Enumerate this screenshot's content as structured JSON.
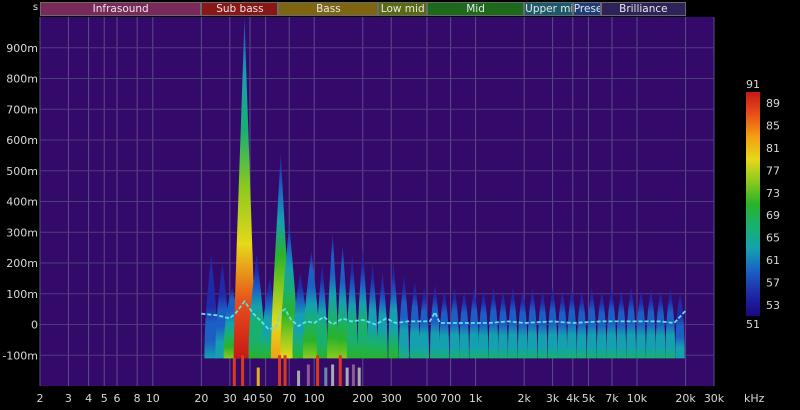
{
  "app": {
    "unit_label": "s"
  },
  "band_strip": [
    {
      "label": "Infrasound",
      "from": 2,
      "to": 20,
      "color": "#7a2a5a"
    },
    {
      "label": "Sub bass",
      "from": 20,
      "to": 60,
      "color": "#8a1616"
    },
    {
      "label": "Bass",
      "from": 60,
      "to": 250,
      "color": "#7d6512"
    },
    {
      "label": "Low mid",
      "from": 250,
      "to": 500,
      "color": "#5a6a12"
    },
    {
      "label": "Mid",
      "from": 500,
      "to": 2000,
      "color": "#1d6a1d"
    },
    {
      "label": "Upper mi",
      "from": 2000,
      "to": 4000,
      "color": "#1a5a6a"
    },
    {
      "label": "Prese",
      "from": 4000,
      "to": 6000,
      "color": "#1c3c7a"
    },
    {
      "label": "Brilliance",
      "from": 6000,
      "to": 20000,
      "color": "#2e2258"
    }
  ],
  "chart_data": {
    "type": "heatmap",
    "title": "",
    "xscale": "log",
    "xlim": [
      2,
      30000
    ],
    "ylim": [
      -200,
      1000
    ],
    "xlabel": "kHz",
    "x_ticks": [
      {
        "v": 2,
        "label": "2"
      },
      {
        "v": 3,
        "label": "3"
      },
      {
        "v": 4,
        "label": "4"
      },
      {
        "v": 5,
        "label": "5"
      },
      {
        "v": 6,
        "label": "6"
      },
      {
        "v": 8,
        "label": "8"
      },
      {
        "v": 10,
        "label": "10"
      },
      {
        "v": 20,
        "label": "20"
      },
      {
        "v": 30,
        "label": "30"
      },
      {
        "v": 40,
        "label": "40"
      },
      {
        "v": 50,
        "label": "50"
      },
      {
        "v": 70,
        "label": "70"
      },
      {
        "v": 100,
        "label": "100"
      },
      {
        "v": 200,
        "label": "200"
      },
      {
        "v": 300,
        "label": "300"
      },
      {
        "v": 500,
        "label": "500"
      },
      {
        "v": 700,
        "label": "700"
      },
      {
        "v": 1000,
        "label": "1k"
      },
      {
        "v": 2000,
        "label": "2k"
      },
      {
        "v": 3000,
        "label": "3k"
      },
      {
        "v": 4000,
        "label": "4k"
      },
      {
        "v": 5000,
        "label": "5k"
      },
      {
        "v": 7000,
        "label": "7k"
      },
      {
        "v": 10000,
        "label": "10k"
      },
      {
        "v": 20000,
        "label": "20k"
      },
      {
        "v": 30000,
        "label": "30k"
      }
    ],
    "y_ticks": [
      {
        "v": 900,
        "label": "900m"
      },
      {
        "v": 800,
        "label": "800m"
      },
      {
        "v": 700,
        "label": "700m"
      },
      {
        "v": 600,
        "label": "600m"
      },
      {
        "v": 500,
        "label": "500m"
      },
      {
        "v": 400,
        "label": "400m"
      },
      {
        "v": 300,
        "label": "300m"
      },
      {
        "v": 200,
        "label": "200m"
      },
      {
        "v": 100,
        "label": "100m"
      },
      {
        "v": 0,
        "label": "0"
      },
      {
        "v": -100,
        "label": "-100m"
      }
    ],
    "colorbar": {
      "max_label": "91",
      "min_label": "51",
      "ticks": [
        "89",
        "85",
        "81",
        "77",
        "73",
        "69",
        "65",
        "61",
        "57",
        "53"
      ],
      "range": [
        51,
        91
      ],
      "colors": [
        "#1a0880",
        "#1e2aa8",
        "#1c5fc4",
        "#15a0b0",
        "#18b070",
        "#29b329",
        "#8cc91e",
        "#e6d81a",
        "#f2a012",
        "#e8501a",
        "#c81818"
      ]
    },
    "background": "#33096a",
    "peaks": [
      {
        "f": 23,
        "top": 230,
        "level": 0.25
      },
      {
        "f": 27,
        "top": 200,
        "level": 0.3
      },
      {
        "f": 31,
        "top": 120,
        "level": 0.55
      },
      {
        "f": 37,
        "top": 1000,
        "level": 1.0
      },
      {
        "f": 44,
        "top": 230,
        "level": 0.5
      },
      {
        "f": 53,
        "top": 150,
        "level": 0.45
      },
      {
        "f": 62,
        "top": 560,
        "level": 0.8
      },
      {
        "f": 70,
        "top": 330,
        "level": 0.65
      },
      {
        "f": 82,
        "top": 170,
        "level": 0.45
      },
      {
        "f": 96,
        "top": 240,
        "level": 0.55
      },
      {
        "f": 112,
        "top": 200,
        "level": 0.5
      },
      {
        "f": 130,
        "top": 300,
        "level": 0.55
      },
      {
        "f": 150,
        "top": 260,
        "level": 0.55
      },
      {
        "f": 172,
        "top": 230,
        "level": 0.5
      },
      {
        "f": 200,
        "top": 250,
        "level": 0.5
      },
      {
        "f": 230,
        "top": 200,
        "level": 0.45
      },
      {
        "f": 265,
        "top": 170,
        "level": 0.45
      },
      {
        "f": 310,
        "top": 200,
        "level": 0.45
      },
      {
        "f": 360,
        "top": 160,
        "level": 0.4
      },
      {
        "f": 420,
        "top": 140,
        "level": 0.4
      },
      {
        "f": 480,
        "top": 120,
        "level": 0.35
      },
      {
        "f": 560,
        "top": 130,
        "level": 0.35
      },
      {
        "f": 640,
        "top": 110,
        "level": 0.35
      },
      {
        "f": 740,
        "top": 120,
        "level": 0.35
      },
      {
        "f": 850,
        "top": 110,
        "level": 0.35
      },
      {
        "f": 980,
        "top": 120,
        "level": 0.35
      },
      {
        "f": 1120,
        "top": 110,
        "level": 0.35
      },
      {
        "f": 1290,
        "top": 120,
        "level": 0.35
      },
      {
        "f": 1480,
        "top": 110,
        "level": 0.35
      },
      {
        "f": 1700,
        "top": 120,
        "level": 0.35
      },
      {
        "f": 1960,
        "top": 110,
        "level": 0.35
      },
      {
        "f": 2250,
        "top": 120,
        "level": 0.35
      },
      {
        "f": 2600,
        "top": 110,
        "level": 0.35
      },
      {
        "f": 3000,
        "top": 120,
        "level": 0.35
      },
      {
        "f": 3450,
        "top": 110,
        "level": 0.35
      },
      {
        "f": 3950,
        "top": 120,
        "level": 0.35
      },
      {
        "f": 4550,
        "top": 110,
        "level": 0.35
      },
      {
        "f": 5250,
        "top": 120,
        "level": 0.35
      },
      {
        "f": 6050,
        "top": 110,
        "level": 0.35
      },
      {
        "f": 6950,
        "top": 120,
        "level": 0.35
      },
      {
        "f": 8000,
        "top": 110,
        "level": 0.35
      },
      {
        "f": 9200,
        "top": 120,
        "level": 0.35
      },
      {
        "f": 10600,
        "top": 110,
        "level": 0.35
      },
      {
        "f": 12200,
        "top": 115,
        "level": 0.35
      },
      {
        "f": 14000,
        "top": 110,
        "level": 0.35
      },
      {
        "f": 16100,
        "top": 115,
        "level": 0.35
      },
      {
        "f": 18500,
        "top": 100,
        "level": 0.3
      }
    ],
    "centroid_line": {
      "x": [
        20,
        25,
        30,
        33,
        37,
        42,
        47,
        52,
        58,
        62,
        66,
        72,
        80,
        90,
        100,
        115,
        130,
        150,
        170,
        200,
        240,
        280,
        320,
        380,
        450,
        520,
        560,
        600,
        700,
        900,
        1200,
        1600,
        2000,
        3000,
        4000,
        6000,
        8000,
        10000,
        14000,
        17000,
        20000
      ],
      "y": [
        35,
        30,
        20,
        40,
        75,
        35,
        10,
        -15,
        -10,
        40,
        50,
        15,
        -5,
        10,
        5,
        25,
        0,
        20,
        10,
        15,
        0,
        20,
        5,
        10,
        10,
        10,
        40,
        5,
        5,
        5,
        5,
        10,
        5,
        10,
        5,
        10,
        10,
        10,
        10,
        5,
        45
      ]
    },
    "transient_marks": [
      {
        "f": 32,
        "color": "#d83a1a",
        "y0": -200,
        "y1": -110
      },
      {
        "f": 36,
        "color": "#d83a1a",
        "y0": -200,
        "y1": -100
      },
      {
        "f": 45,
        "color": "#e0b020",
        "y0": -200,
        "y1": -140
      },
      {
        "f": 61,
        "color": "#d83a1a",
        "y0": -200,
        "y1": -100
      },
      {
        "f": 66,
        "color": "#d83a1a",
        "y0": -200,
        "y1": -100
      },
      {
        "f": 80,
        "color": "#aaaaaa",
        "y0": -200,
        "y1": -150
      },
      {
        "f": 92,
        "color": "#8a5a90",
        "y0": -200,
        "y1": -130
      },
      {
        "f": 105,
        "color": "#d83a1a",
        "y0": -200,
        "y1": -100
      },
      {
        "f": 118,
        "color": "#6a8aaa",
        "y0": -200,
        "y1": -140
      },
      {
        "f": 130,
        "color": "#aaaaaa",
        "y0": -200,
        "y1": -130
      },
      {
        "f": 145,
        "color": "#d83a1a",
        "y0": -200,
        "y1": -100
      },
      {
        "f": 160,
        "color": "#aaaaaa",
        "y0": -200,
        "y1": -140
      },
      {
        "f": 175,
        "color": "#8a5a90",
        "y0": -200,
        "y1": -130
      },
      {
        "f": 190,
        "color": "#aaaaaa",
        "y0": -200,
        "y1": -140
      }
    ]
  }
}
